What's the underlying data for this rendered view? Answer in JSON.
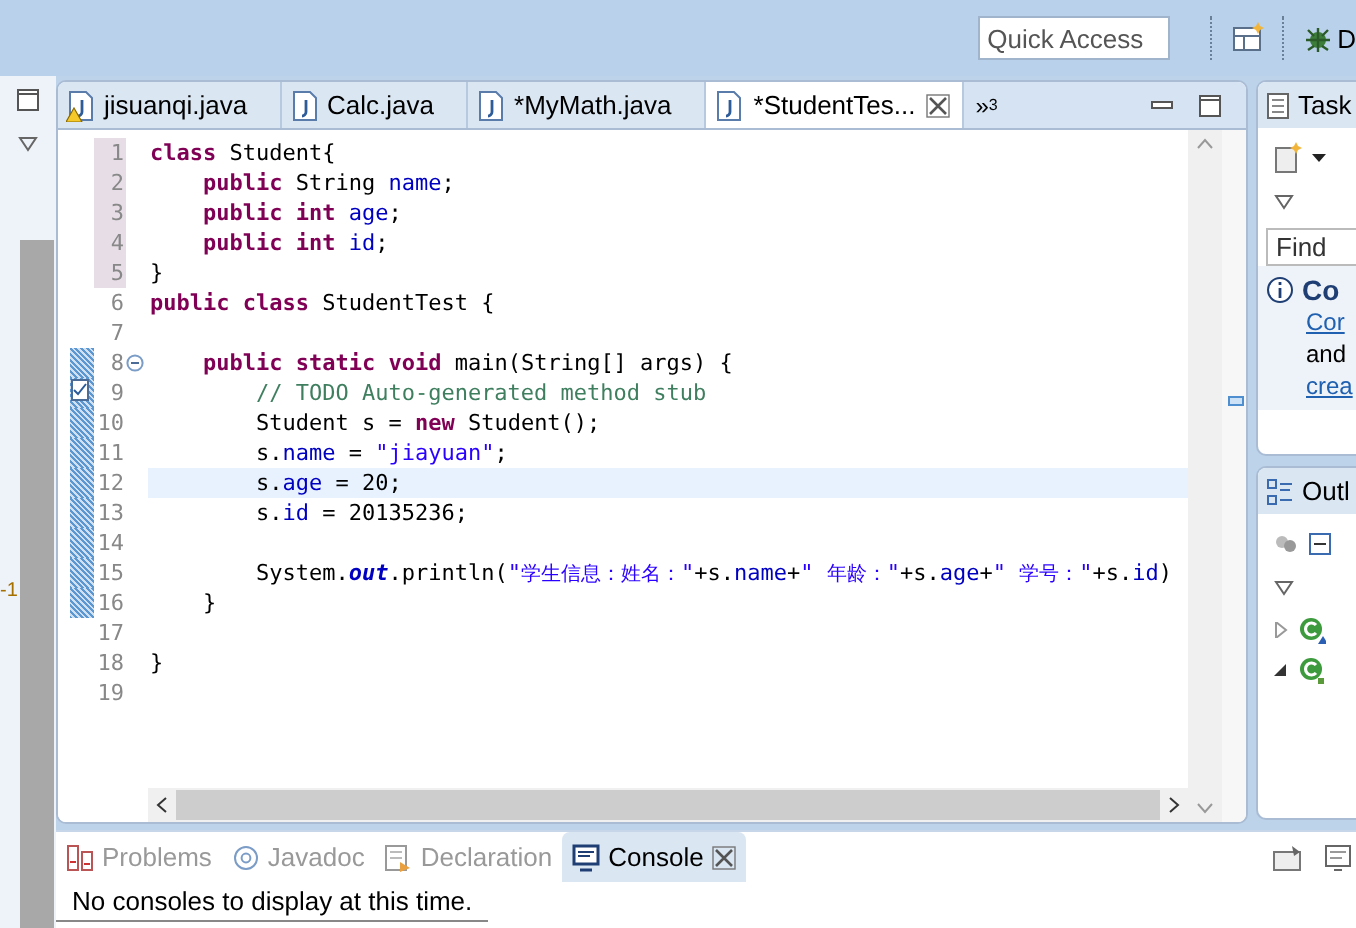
{
  "toolbar": {
    "quick_access": {
      "placeholder": "Quick Access"
    },
    "perspective_label": "D"
  },
  "left_strip": {
    "label": "-1"
  },
  "editor": {
    "tabs": [
      {
        "label": "jisuanqi.java",
        "selected": false,
        "warning": true
      },
      {
        "label": "Calc.java",
        "selected": false,
        "warning": false
      },
      {
        "label": "*MyMath.java",
        "selected": false,
        "warning": false
      },
      {
        "label": "*StudentTes...",
        "selected": true,
        "warning": false
      }
    ],
    "overflow": {
      "label": "»",
      "count": "3"
    },
    "lines": [
      {
        "number": "1",
        "kind": "plain",
        "shaded": true,
        "changed": false,
        "current": false,
        "tokens": [
          {
            "kind": "keyword",
            "text": "class"
          },
          {
            "kind": "plain",
            "text": " Student{"
          }
        ]
      },
      {
        "number": "2",
        "kind": "plain",
        "shaded": true,
        "changed": false,
        "current": false,
        "tokens": [
          {
            "kind": "keyword",
            "text": "    public"
          },
          {
            "kind": "plain",
            "text": " String "
          },
          {
            "kind": "field",
            "text": "name"
          },
          {
            "kind": "plain",
            "text": ";"
          }
        ]
      },
      {
        "number": "3",
        "kind": "plain",
        "shaded": true,
        "changed": false,
        "current": false,
        "tokens": [
          {
            "kind": "keyword",
            "text": "    public "
          },
          {
            "kind": "keyword",
            "text": "int "
          },
          {
            "kind": "field",
            "text": "age"
          },
          {
            "kind": "plain",
            "text": ";"
          }
        ]
      },
      {
        "number": "4",
        "kind": "plain",
        "shaded": true,
        "changed": false,
        "current": false,
        "tokens": [
          {
            "kind": "keyword",
            "text": "    public "
          },
          {
            "kind": "keyword",
            "text": "int "
          },
          {
            "kind": "field",
            "text": "id"
          },
          {
            "kind": "plain",
            "text": ";"
          }
        ]
      },
      {
        "number": "5",
        "kind": "plain",
        "shaded": true,
        "changed": false,
        "current": false,
        "tokens": [
          {
            "kind": "plain",
            "text": "}"
          }
        ]
      },
      {
        "number": "6",
        "kind": "plain",
        "shaded": false,
        "changed": false,
        "current": false,
        "tokens": [
          {
            "kind": "keyword",
            "text": "public "
          },
          {
            "kind": "keyword",
            "text": "class"
          },
          {
            "kind": "plain",
            "text": " StudentTest {"
          }
        ]
      },
      {
        "number": "7",
        "kind": "plain",
        "shaded": false,
        "changed": false,
        "current": false
      },
      {
        "number": "8",
        "kind": "fold",
        "shaded": false,
        "changed": true,
        "current": false,
        "tokens": [
          {
            "kind": "keyword",
            "text": "    public "
          },
          {
            "kind": "keyword",
            "text": "static "
          },
          {
            "kind": "keyword",
            "text": "void"
          },
          {
            "kind": "plain",
            "text": " main(String[] args) {"
          }
        ]
      },
      {
        "number": "9",
        "kind": "task",
        "shaded": false,
        "changed": true,
        "current": false,
        "tokens": [
          {
            "kind": "comment",
            "text": "        // TODO Auto-generated method stub"
          }
        ]
      },
      {
        "number": "10",
        "kind": "plain",
        "shaded": false,
        "changed": true,
        "current": false,
        "tokens": [
          {
            "kind": "plain",
            "text": "        Student s = "
          },
          {
            "kind": "keyword",
            "text": "new"
          },
          {
            "kind": "plain",
            "text": " Student();"
          }
        ]
      },
      {
        "number": "11",
        "kind": "plain",
        "shaded": false,
        "changed": true,
        "current": false,
        "tokens": [
          {
            "kind": "plain",
            "text": "        s."
          },
          {
            "kind": "field",
            "text": "name"
          },
          {
            "kind": "plain",
            "text": " = "
          },
          {
            "kind": "string",
            "text": "\"jiayuan\""
          },
          {
            "kind": "plain",
            "text": ";"
          }
        ]
      },
      {
        "number": "12",
        "kind": "plain",
        "shaded": false,
        "changed": true,
        "current": true,
        "tokens": [
          {
            "kind": "plain",
            "text": "        s."
          },
          {
            "kind": "field",
            "text": "age"
          },
          {
            "kind": "plain",
            "text": " = 20;"
          }
        ]
      },
      {
        "number": "13",
        "kind": "plain",
        "shaded": false,
        "changed": true,
        "current": false,
        "tokens": [
          {
            "kind": "plain",
            "text": "        s."
          },
          {
            "kind": "field",
            "text": "id"
          },
          {
            "kind": "plain",
            "text": " = 20135236;"
          }
        ]
      },
      {
        "number": "14",
        "kind": "plain",
        "shaded": false,
        "changed": true,
        "current": false
      },
      {
        "number": "15",
        "kind": "plain",
        "shaded": false,
        "changed": true,
        "current": false,
        "tokens": [
          {
            "kind": "plain",
            "text": "        System."
          },
          {
            "kind": "static",
            "text": "out"
          },
          {
            "kind": "plain",
            "text": ".println("
          },
          {
            "kind": "string",
            "text": "\""
          },
          {
            "kind": "string-cjk",
            "text": "学生信息：姓名："
          },
          {
            "kind": "string",
            "text": "\""
          },
          {
            "kind": "plain",
            "text": "+s."
          },
          {
            "kind": "field",
            "text": "name"
          },
          {
            "kind": "plain",
            "text": "+"
          },
          {
            "kind": "string",
            "text": "\" "
          },
          {
            "kind": "string-cjk",
            "text": "年龄："
          },
          {
            "kind": "string",
            "text": "\""
          },
          {
            "kind": "plain",
            "text": "+s."
          },
          {
            "kind": "field",
            "text": "age"
          },
          {
            "kind": "plain",
            "text": "+"
          },
          {
            "kind": "string",
            "text": "\" "
          },
          {
            "kind": "string-cjk",
            "text": "学号："
          },
          {
            "kind": "string",
            "text": "\""
          },
          {
            "kind": "plain",
            "text": "+s."
          },
          {
            "kind": "field",
            "text": "id"
          },
          {
            "kind": "plain",
            "text": ")"
          }
        ]
      },
      {
        "number": "16",
        "kind": "plain",
        "shaded": false,
        "changed": true,
        "current": false,
        "tokens": [
          {
            "kind": "plain",
            "text": "    }"
          }
        ]
      },
      {
        "number": "17",
        "kind": "plain",
        "shaded": false,
        "changed": false,
        "current": false
      },
      {
        "number": "18",
        "kind": "plain",
        "shaded": false,
        "changed": false,
        "current": false,
        "tokens": [
          {
            "kind": "plain",
            "text": "}"
          }
        ]
      },
      {
        "number": "19",
        "kind": "plain",
        "shaded": false,
        "changed": false,
        "current": false
      }
    ]
  },
  "tasks": {
    "title": "Task",
    "find": {
      "placeholder": "Find"
    },
    "info_title": "Co",
    "link_1": "Cor",
    "text": "and",
    "link_2": "crea"
  },
  "outline": {
    "title": "Outl",
    "items": [
      {
        "expanded": false
      },
      {
        "expanded": true
      }
    ]
  },
  "console": {
    "tabs": [
      {
        "label": "Problems",
        "selected": false
      },
      {
        "label": "Javadoc",
        "selected": false
      },
      {
        "label": "Declaration",
        "selected": false
      },
      {
        "label": "Console",
        "selected": true
      }
    ],
    "message": "No consoles to display at this time."
  }
}
